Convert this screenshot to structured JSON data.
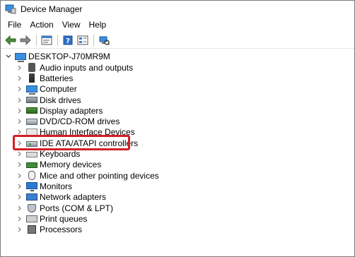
{
  "window": {
    "title": "Device Manager"
  },
  "menu": {
    "items": [
      "File",
      "Action",
      "View",
      "Help"
    ]
  },
  "toolbar": {
    "buttons": [
      "back-icon",
      "forward-icon",
      "properties-icon",
      "help-icon",
      "view-icon",
      "scan-hardware-icon"
    ]
  },
  "tree": {
    "root": "DESKTOP-J70MR9M",
    "items": [
      "Audio inputs and outputs",
      "Batteries",
      "Computer",
      "Disk drives",
      "Display adapters",
      "DVD/CD-ROM drives",
      "Human Interface Devices",
      "IDE ATA/ATAPI controllers",
      "Keyboards",
      "Memory devices",
      "Mice and other pointing devices",
      "Monitors",
      "Network adapters",
      "Ports (COM & LPT)",
      "Print queues",
      "Processors"
    ]
  },
  "highlight": {
    "color": "#d21f26",
    "target": "IDE ATA/ATAPI controllers"
  }
}
